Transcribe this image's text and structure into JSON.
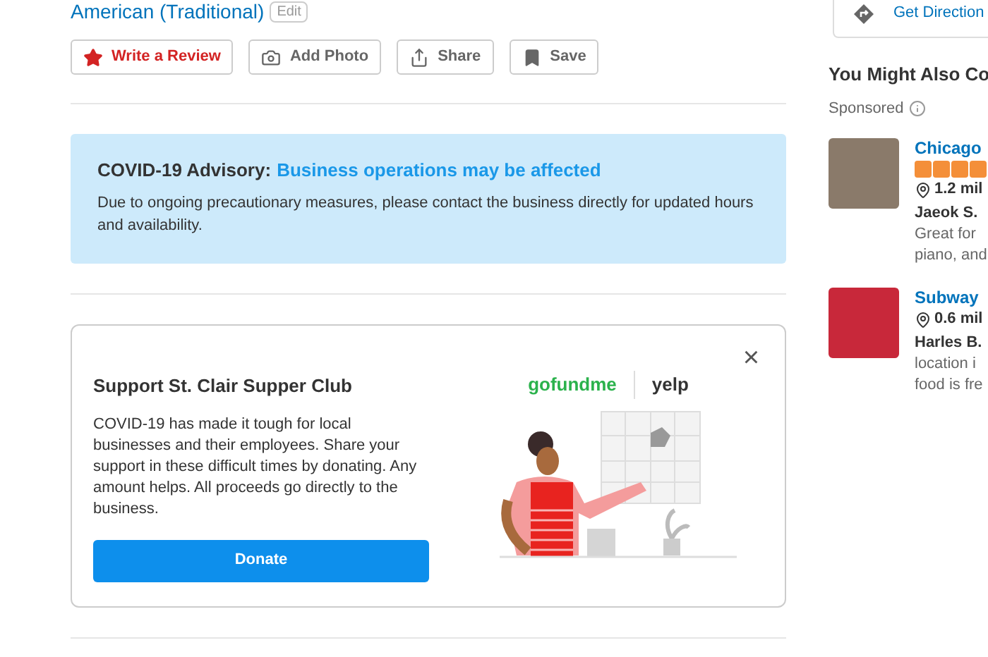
{
  "category": {
    "label": "American (Traditional)",
    "edit": "Edit"
  },
  "actions": [
    {
      "kind": "review",
      "label": "Write a Review"
    },
    {
      "kind": "photo",
      "label": "Add Photo"
    },
    {
      "kind": "share",
      "label": "Share"
    },
    {
      "kind": "save",
      "label": "Save"
    }
  ],
  "advisory": {
    "title": "COVID-19 Advisory:",
    "headline": "Business operations may be affected",
    "text": "Due to ongoing precautionary measures, please contact the business directly for updated hours and availability."
  },
  "donation": {
    "title": "Support St. Clair Supper Club",
    "text": "COVID-19 has made it tough for local businesses and their employees. Share your support in these difficult times by donating. Any amount helps. All proceeds go directly to the business.",
    "button": "Donate",
    "close": "×",
    "logos": [
      "gofundme",
      "yelp"
    ]
  },
  "sidebar": {
    "directions": "Get Direction",
    "heading": "You Might Also Co",
    "sponsored": "Sponsored",
    "items": [
      {
        "name": "Chicago",
        "stars": 4,
        "distance": "1.2 mil",
        "reviewer": "Jaeok S.",
        "snippet": [
          "Great for",
          "piano, and"
        ]
      },
      {
        "name": "Subway",
        "distance": "0.6 mil",
        "reviewer": "Harles B.",
        "snippet": [
          "location i",
          "food is fre"
        ]
      }
    ]
  }
}
